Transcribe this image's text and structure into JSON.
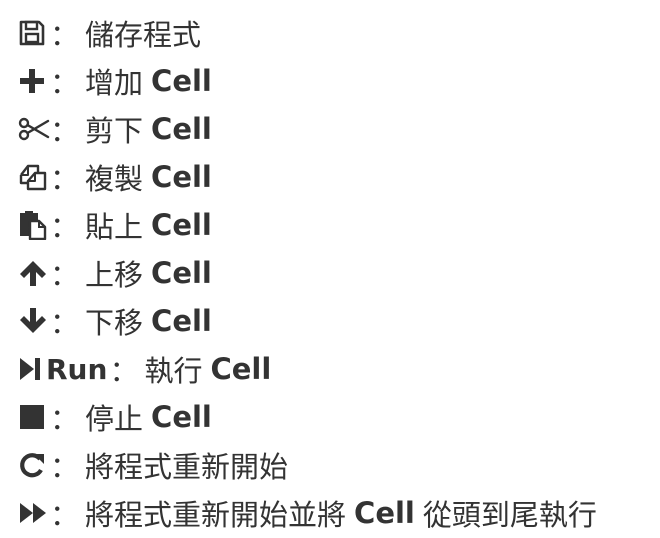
{
  "separator": "：",
  "items": [
    {
      "icon": "save-icon",
      "desc": "儲存程式"
    },
    {
      "icon": "plus-icon",
      "desc": "增加",
      "term": "Cell"
    },
    {
      "icon": "scissors-icon",
      "desc": "剪下",
      "term": "Cell"
    },
    {
      "icon": "copy-icon",
      "desc": "複製",
      "term": "Cell"
    },
    {
      "icon": "paste-icon",
      "desc": "貼上",
      "term": "Cell"
    },
    {
      "icon": "arrow-up-icon",
      "desc": "上移",
      "term": "Cell"
    },
    {
      "icon": "arrow-down-icon",
      "desc": "下移",
      "term": "Cell"
    },
    {
      "icon": "step-forward-icon",
      "label": "Run",
      "desc": "執行",
      "term": "Cell"
    },
    {
      "icon": "stop-icon",
      "desc": "停止",
      "term": "Cell"
    },
    {
      "icon": "redo-icon",
      "desc": "將程式重新開始"
    },
    {
      "icon": "fast-forward-icon",
      "desc": "將程式重新開始並將",
      "term": "Cell",
      "tail": "從頭到尾執行"
    }
  ]
}
